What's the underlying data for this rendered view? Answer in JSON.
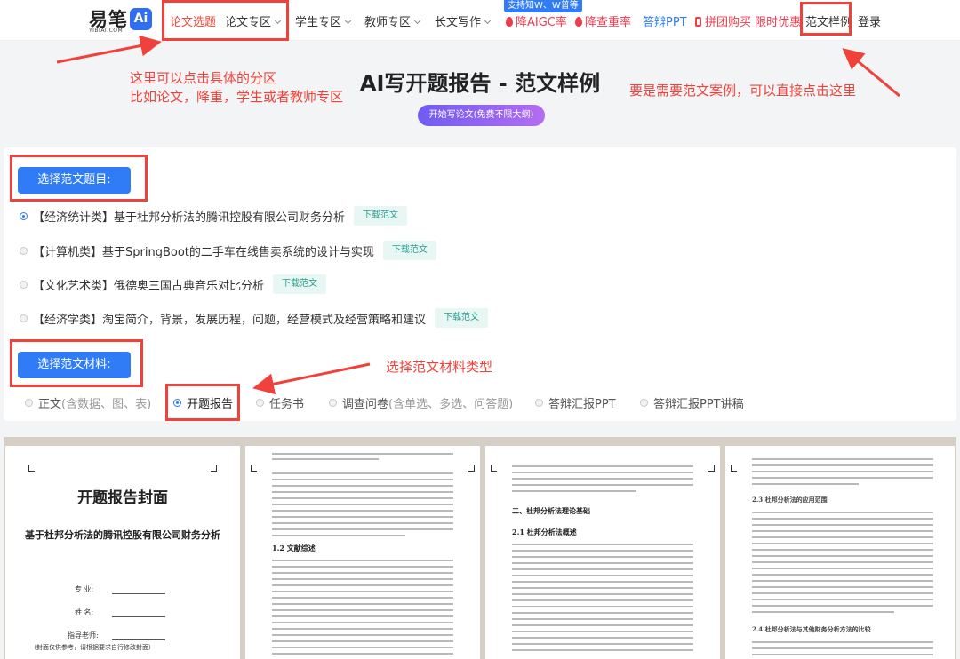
{
  "header": {
    "logo_text": "易笔",
    "logo_ai": "Ai",
    "logo_sub": "YIBIAI.COM",
    "badge": "支持知W、W普等",
    "nav": [
      {
        "label": "论文选题"
      },
      {
        "label": "论文专区"
      },
      {
        "label": "学生专区"
      },
      {
        "label": "教师专区"
      },
      {
        "label": "长文写作"
      },
      {
        "label": "降AIGC率"
      },
      {
        "label": "降查重率"
      },
      {
        "label": "答辩PPT"
      },
      {
        "label": "拼团购买 限时优惠"
      },
      {
        "label": "范文样例"
      },
      {
        "label": "登录"
      }
    ]
  },
  "hero": {
    "title": "AI写开题报告 - 范文样例",
    "start_button": "开始写论文(免费不限大纲)"
  },
  "annotations": {
    "left_line1": "这里可以点击具体的分区",
    "left_line2": "比如论文，降重，学生或者教师专区",
    "right": "要是需要范文案例，可以直接点击这里",
    "material": "选择范文材料类型"
  },
  "topics": {
    "select_label": "选择范文题目:",
    "download_label": "下载范文",
    "items": [
      {
        "text": "【经济统计类】基于杜邦分析法的腾讯控股有限公司财务分析"
      },
      {
        "text": "【计算机类】基于SpringBoot的二手车在线售卖系统的设计与实现"
      },
      {
        "text": "【文化艺术类】俄德奥三国古典音乐对比分析"
      },
      {
        "text": "【经济学类】淘宝简介，背景，发展历程，问题，经营模式及经营策略和建议"
      }
    ]
  },
  "materials": {
    "select_label": "选择范文材料:",
    "items": [
      {
        "label": "正文",
        "hint": "(含数据、图、表)"
      },
      {
        "label": "开题报告",
        "hint": ""
      },
      {
        "label": "任务书",
        "hint": ""
      },
      {
        "label": "调查问卷",
        "hint": "(含单选、多选、问答题)"
      },
      {
        "label": "答辩汇报PPT",
        "hint": ""
      },
      {
        "label": "答辩汇报PPT讲稿",
        "hint": ""
      }
    ],
    "selected": "开题报告"
  },
  "preview": {
    "cover_title": "开题报告封面",
    "cover_subtitle": "基于杜邦分析法的腾讯控股有限公司财务分析",
    "fields": [
      "专  业:",
      "姓  名:",
      "指导老师:"
    ],
    "note": "（封面仅供参考，请根据要求自行修改封面）",
    "p2_heading": "1.2 文献综述",
    "p3_heading": "二、杜邦分析法理论基础",
    "p3_sub": "2.1 杜邦分析法概述",
    "p4_sub1": "2.3 杜邦分析法的应用范围",
    "p4_sub2": "2.4 杜邦分析法与其他财务分析方法的比较"
  },
  "colors": {
    "accent": "#2f7cf6",
    "annotation": "#f0423a",
    "download_bg": "#e8f6f4"
  }
}
